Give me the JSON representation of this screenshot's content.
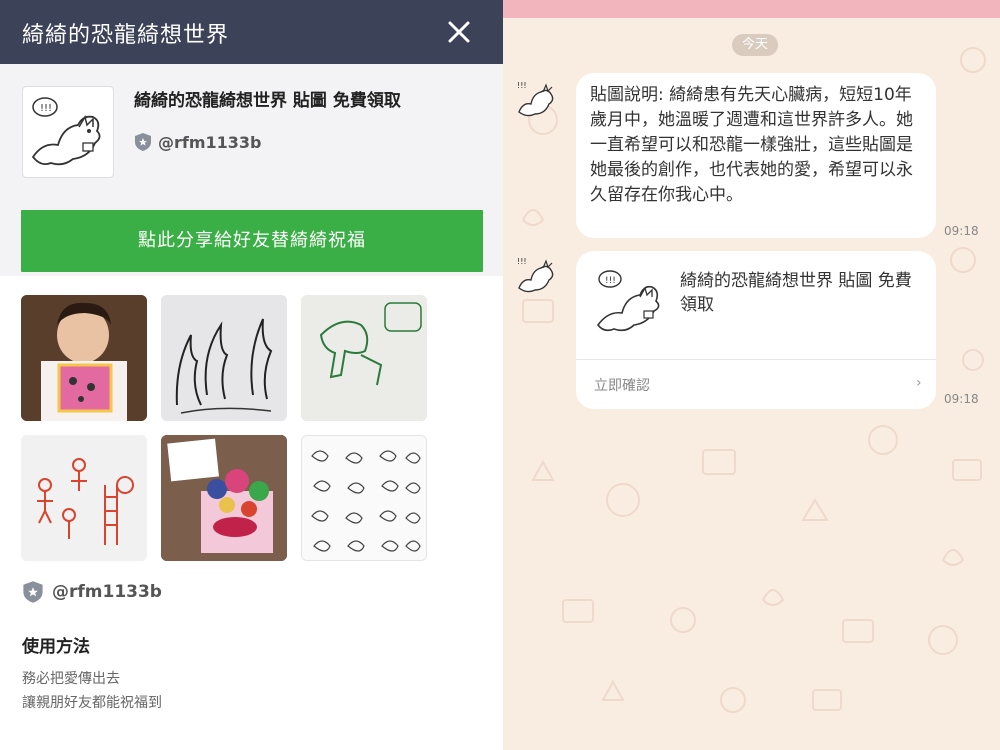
{
  "header": {
    "title": "綺綺的恐龍綺想世界"
  },
  "product": {
    "title": "綺綺的恐龍綺想世界 貼圖 免費領取",
    "author": "@rfm1133b",
    "share_button": "點此分享給好友替綺綺祝福"
  },
  "author_footer": "@rfm1133b",
  "usage": {
    "heading": "使用方法",
    "line1": "務必把愛傳出去",
    "line2": "讓親朋好友都能祝福到"
  },
  "chat": {
    "date": "今天",
    "message1": "貼圖說明: 綺綺患有先天心臟病，短短10年歲月中，她溫暖了週遭和這世界許多人。她一直希望可以和恐龍一樣強壯，這些貼圖是她最後的創作，也代表她的愛，希望可以永久留存在你我心中。",
    "time1": "09:18",
    "card_title": "綺綺的恐龍綺想世界 貼圖 免費領取",
    "card_action": "立即確認",
    "card_chevron": "›",
    "time2": "09:18"
  },
  "colors": {
    "header_bg": "#3c4258",
    "share_green": "#3aaf45",
    "chat_bg": "#f9ede2",
    "top_pink": "#f2b4bd"
  },
  "icons": {
    "close": "close-icon",
    "badge": "shield-badge-icon"
  }
}
